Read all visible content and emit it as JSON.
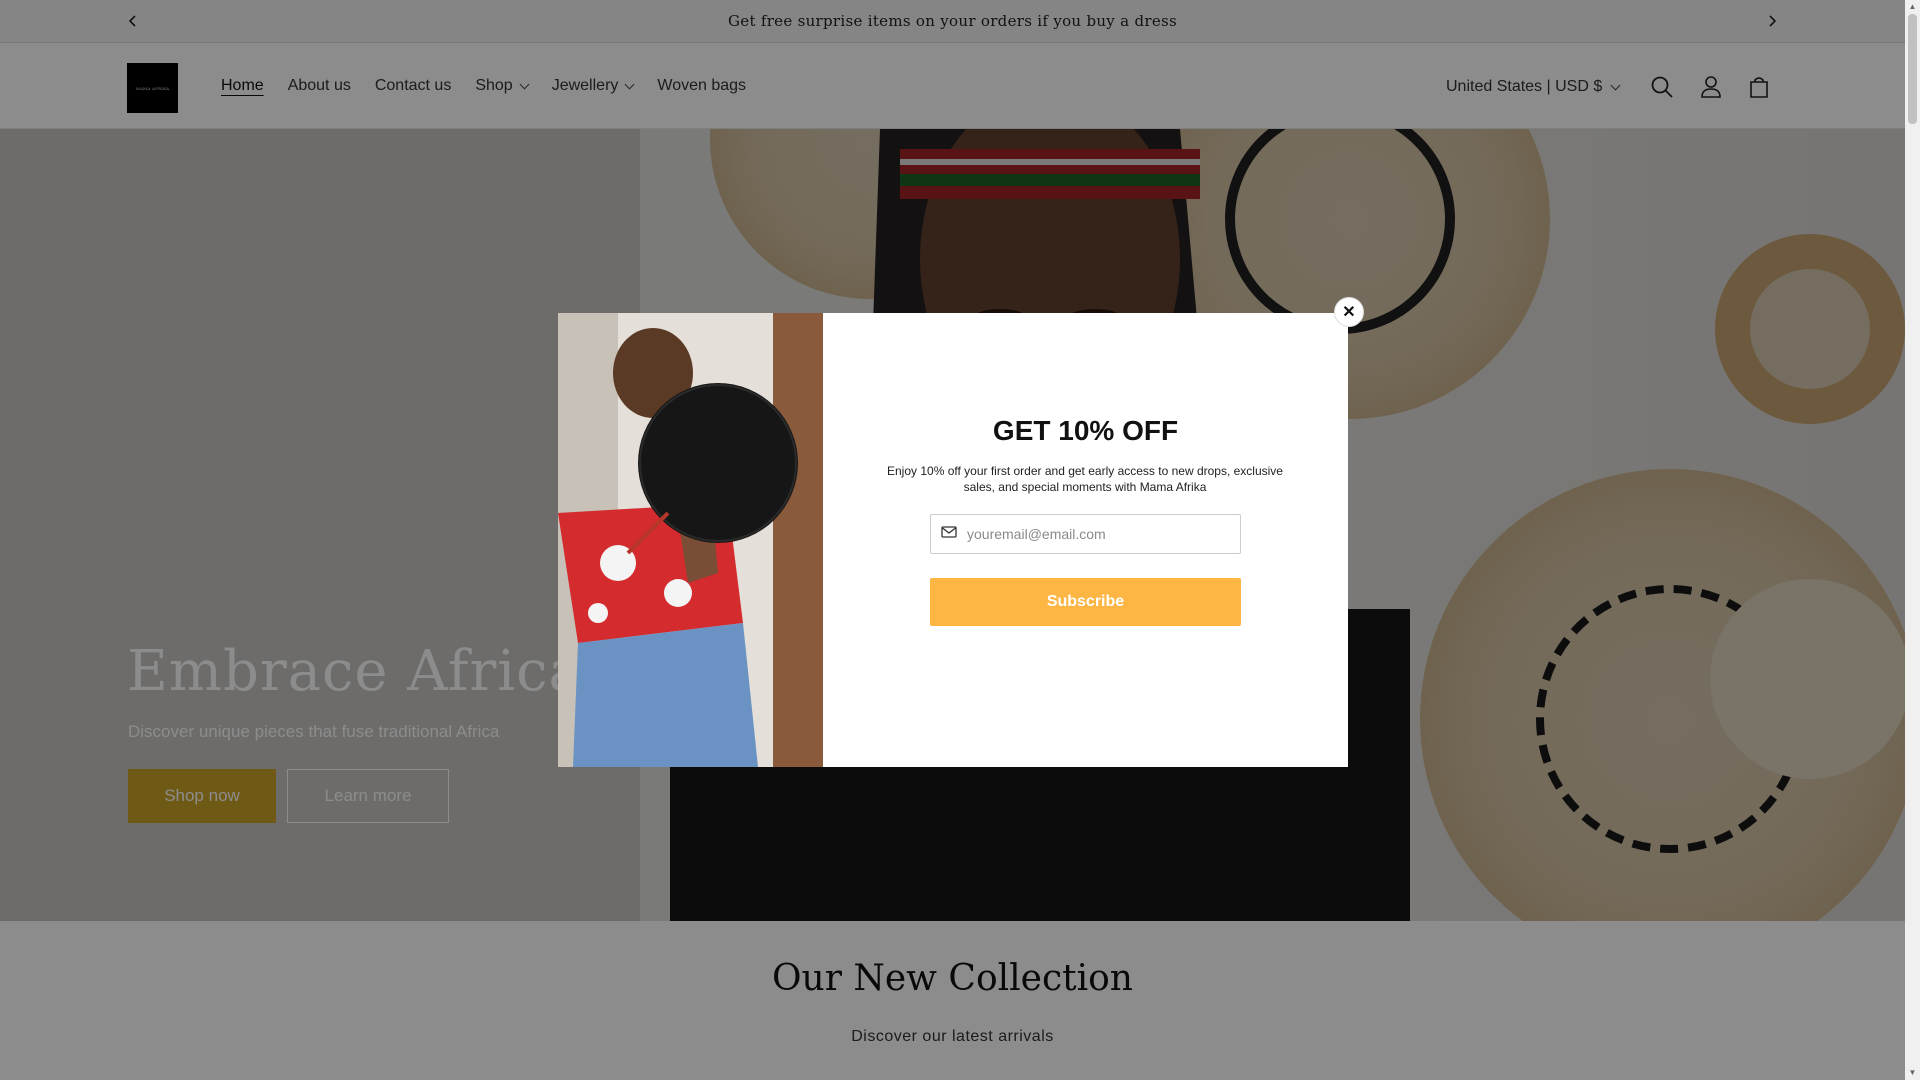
{
  "announcement": {
    "text": "Get free surprise items on your orders if you buy a dress"
  },
  "header": {
    "logo_text": "MAMA AFRIKA",
    "nav": [
      {
        "label": "Home"
      },
      {
        "label": "About us"
      },
      {
        "label": "Contact us"
      },
      {
        "label": "Shop"
      },
      {
        "label": "Jewellery"
      },
      {
        "label": "Woven bags"
      }
    ],
    "currency": "United States | USD $",
    "icons": [
      "search-icon",
      "account-icon",
      "cart-icon"
    ]
  },
  "hero": {
    "title": "Embrace African",
    "subtitle": "Discover unique pieces that fuse traditional Africa",
    "shop_label": "Shop now",
    "learn_label": "Learn more",
    "accent_color": "#c9a227"
  },
  "collection": {
    "title": "Our New Collection",
    "subtitle": "Discover our latest arrivals"
  },
  "popup": {
    "title": "GET 10% OFF",
    "description": "Enjoy 10% off your first order and get early access to new drops, exclusive sales, and special moments with Mama Afrika",
    "email_placeholder": "youremail@email.com",
    "subscribe_label": "Subscribe",
    "button_color": "#fdb644",
    "close_label": "✕"
  }
}
